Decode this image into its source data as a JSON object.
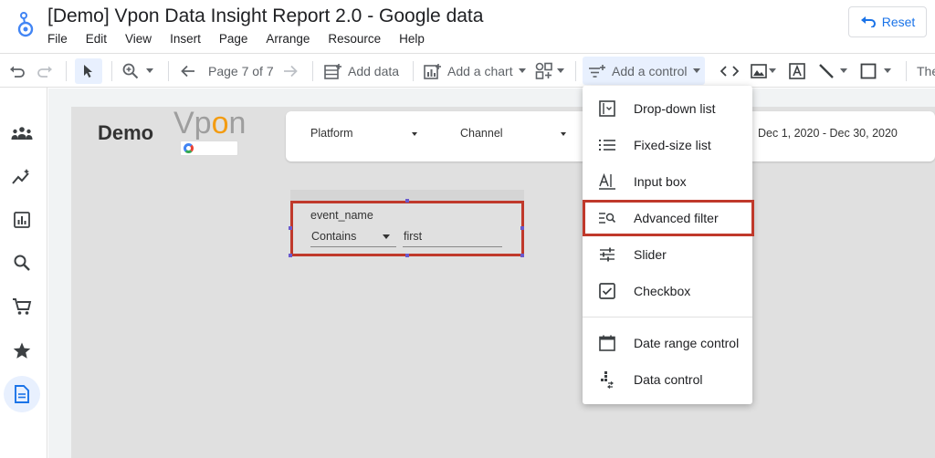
{
  "app": {
    "title": "[Demo] Vpon Data Insight Report 2.0 - Google data",
    "reset_label": "Reset"
  },
  "menubar": [
    "File",
    "Edit",
    "View",
    "Insert",
    "Page",
    "Arrange",
    "Resource",
    "Help"
  ],
  "toolbar": {
    "page_indicator": "Page 7 of 7",
    "add_data": "Add data",
    "add_chart": "Add a chart",
    "add_control": "Add a control",
    "theme_partial": "The"
  },
  "report": {
    "brand_demo": "Demo",
    "brand_vpon_a": "Vp",
    "brand_vpon_b": "o",
    "brand_vpon_c": "n",
    "filters": {
      "platform": "Platform",
      "channel": "Channel",
      "date_range": "Dec 1, 2020 - Dec 30, 2020"
    },
    "advanced_filter": {
      "field": "event_name",
      "operator": "Contains",
      "value": "first"
    }
  },
  "control_menu": {
    "items": [
      {
        "label": "Drop-down list",
        "icon": "dropdown-list-icon"
      },
      {
        "label": "Fixed-size list",
        "icon": "fixed-list-icon"
      },
      {
        "label": "Input box",
        "icon": "input-box-icon"
      },
      {
        "label": "Advanced filter",
        "icon": "advanced-filter-icon"
      },
      {
        "label": "Slider",
        "icon": "slider-icon"
      },
      {
        "label": "Checkbox",
        "icon": "checkbox-icon"
      },
      {
        "label": "Date range control",
        "icon": "calendar-icon"
      },
      {
        "label": "Data control",
        "icon": "data-control-icon"
      }
    ]
  },
  "colors": {
    "accent": "#1a73e8",
    "highlight": "#c0392b",
    "vpon_orange": "#f39c12"
  }
}
